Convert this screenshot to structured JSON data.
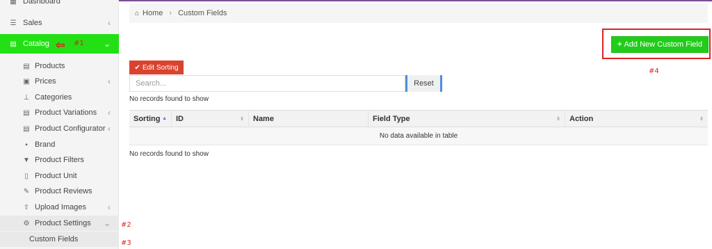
{
  "sidebar": {
    "dashboard": {
      "label": "Dashboard",
      "icon": "dashboard-icon"
    },
    "sales": {
      "label": "Sales",
      "icon": "sales-icon"
    },
    "catalog": {
      "label": "Catalog",
      "icon": "catalog-icon",
      "annotation": "#1"
    },
    "items": [
      {
        "label": "Products",
        "icon": "list-icon"
      },
      {
        "label": "Prices",
        "icon": "money-icon"
      },
      {
        "label": "Categories",
        "icon": "sitemap-icon"
      },
      {
        "label": "Product Variations",
        "icon": "list-icon"
      },
      {
        "label": "Product Configurator",
        "icon": "list-icon"
      },
      {
        "label": "Brand",
        "icon": "gift-icon"
      },
      {
        "label": "Product Filters",
        "icon": "filter-icon"
      },
      {
        "label": "Product Unit",
        "icon": "unit-icon"
      },
      {
        "label": "Product Reviews",
        "icon": "edit-icon"
      },
      {
        "label": "Upload Images",
        "icon": "upload-icon"
      },
      {
        "label": "Product Settings",
        "icon": "gear-icon"
      }
    ],
    "custom_fields": "Custom Fields",
    "annot2": "#2",
    "annot3": "#3"
  },
  "breadcrumb": {
    "home": "Home",
    "current": "Custom Fields"
  },
  "add_button": {
    "label": "Add New Custom Field",
    "annotation": "#4"
  },
  "edit_sorting": "Edit Sorting",
  "search": {
    "placeholder": "Search..."
  },
  "reset": "Reset",
  "no_records_top": "No records found to show",
  "no_records_bottom": "No records found to show",
  "table": {
    "headers": [
      "Sorting",
      "ID",
      "Name",
      "Field Type",
      "Action"
    ],
    "empty": "No data available in table"
  },
  "colors": {
    "catalog": "#22e014",
    "add_button": "#22cc1a",
    "edit_sorting": "#d9432f",
    "annotation": "#e02020"
  }
}
